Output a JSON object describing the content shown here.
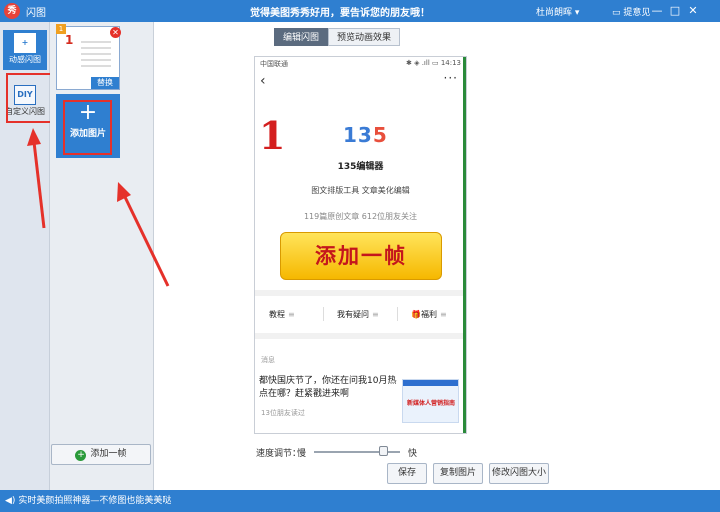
{
  "titlebar": {
    "app_title": "闪图",
    "slogan": "觉得美图秀秀好用，要告诉您的朋友哦！",
    "user": "杜尚朗晖",
    "feedback": "提意见",
    "minimize": "—",
    "maximize": "□",
    "close": "✕"
  },
  "sidebar": {
    "items": [
      {
        "label": "动感闪图",
        "icon": "plus-frame-icon",
        "glyph": "+"
      },
      {
        "label": "自定义闪图",
        "icon": "diy-icon",
        "glyph": "DIY"
      }
    ]
  },
  "thumbs": {
    "frame_index": "1",
    "frame_number": "1",
    "replace_label": "替换",
    "close_glyph": "✕",
    "add_picture_glyph": "+",
    "add_picture_label": "添加图片",
    "add_frame_label": "添加一帧",
    "add_frame_glyph": "+"
  },
  "tabs": {
    "edit": "编辑闪图",
    "preview": "预览动画效果"
  },
  "phone": {
    "carrier": "中国联通",
    "status_right": "✱ ◈ .ıll ▭ 14:13",
    "back_glyph": "‹",
    "more_glyph": "···",
    "big_number": "1",
    "logo_part1": "13",
    "logo_part2": "5",
    "account_name": "135编辑器",
    "account_desc": "图文排版工具  文章美化编辑",
    "account_stats": "119篇原创文章  612位朋友关注",
    "follow_button": "添加一帧",
    "menu": [
      "教程",
      "我有疑问",
      "福利"
    ],
    "menu_glyph": "≡",
    "msg_header": "消息",
    "article_title": "都快国庆节了，你还在问我10月热点在哪？赶紧戳进来啊",
    "article_meta": "13位朋友读过",
    "article_image_text": "新媒体人营销指南"
  },
  "controls": {
    "speed_label": "速度调节：",
    "slow": "慢",
    "fast": "快",
    "speed_value": 0.85,
    "save": "保存",
    "copy_image": "复制图片",
    "resize": "修改闪图大小"
  },
  "statusbar": {
    "text": "实时美颜拍照神器—不修图也能美美哒",
    "speaker_glyph": "◀)"
  },
  "colors": {
    "titlebar": "#2f7fd0",
    "highlight": "#e5312a",
    "follow_button": "#f6b800"
  }
}
